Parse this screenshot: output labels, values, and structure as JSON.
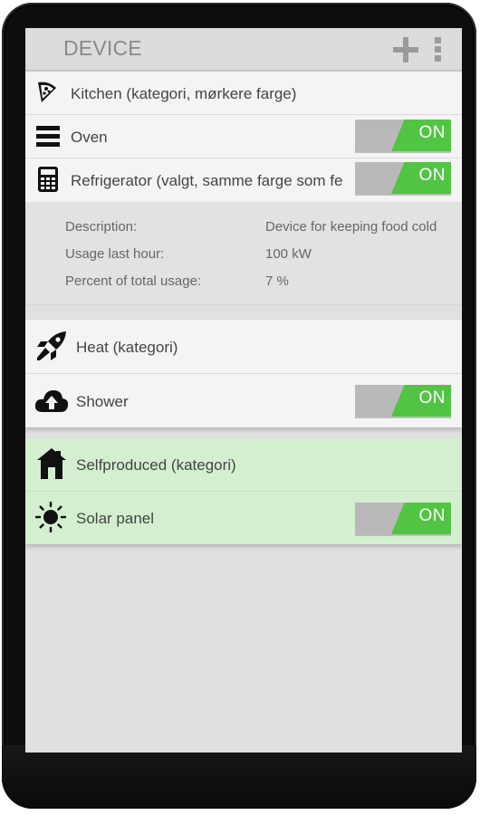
{
  "appbar": {
    "title": "DEVICE",
    "add_icon": "plus-icon",
    "menu_icon": "more-vertical-icon"
  },
  "groups": [
    {
      "category": {
        "label": "Kitchen (kategori, mørkere farge)",
        "icon": "pizza-slice-icon"
      },
      "devices": [
        {
          "label": "Oven",
          "icon": "menu-lines-icon",
          "toggle": "ON"
        },
        {
          "label": "Refrigerator (valgt, samme farge som fe",
          "icon": "calculator-icon",
          "toggle": "ON",
          "details": [
            {
              "label": "Description:",
              "value": "Device for keeping food cold"
            },
            {
              "label": "Usage last hour:",
              "value": "100 kW"
            },
            {
              "label": "Percent of total usage:",
              "value": "7 %"
            }
          ]
        }
      ]
    },
    {
      "category": {
        "label": "Heat (kategori)",
        "icon": "rocket-icon"
      },
      "devices": [
        {
          "label": "Shower",
          "icon": "cloud-upload-icon",
          "toggle": "ON"
        }
      ]
    },
    {
      "category": {
        "label": "Selfproduced (kategori)",
        "icon": "home-icon"
      },
      "devices": [
        {
          "label": "Solar panel",
          "icon": "sun-icon",
          "toggle": "ON"
        }
      ]
    }
  ],
  "colors": {
    "on_green": "#52c443",
    "selfproduced_bg": "#d3efd0",
    "row_bg": "#f4f4f4"
  }
}
